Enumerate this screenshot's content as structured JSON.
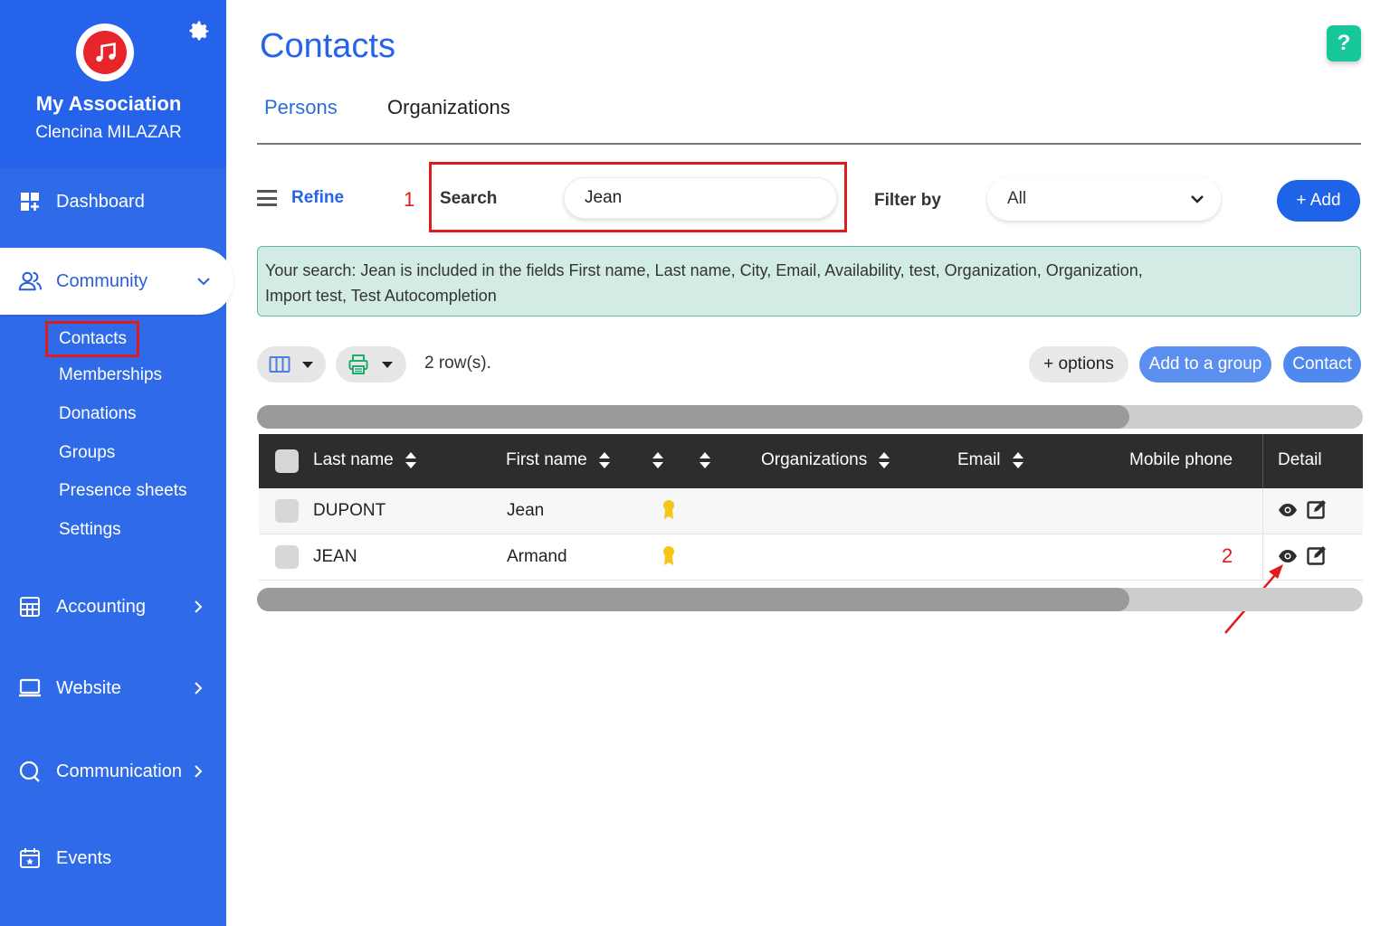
{
  "sidebar": {
    "assoc_name": "My Association",
    "user_name": "Clencina MILAZAR",
    "logo_icon": "music-note-icon",
    "settings_icon": "gear-icon",
    "dashboard": "Dashboard",
    "community": "Community",
    "sub_items": [
      "Contacts",
      "Memberships",
      "Donations",
      "Groups",
      "Presence sheets",
      "Settings"
    ],
    "accounting": "Accounting",
    "website": "Website",
    "communication": "Communication",
    "events": "Events"
  },
  "page": {
    "title": "Contacts",
    "help": "?",
    "tabs": [
      "Persons",
      "Organizations"
    ]
  },
  "toolbar": {
    "refine": "Refine",
    "annotation_1": "1",
    "search_label": "Search",
    "search_value": "Jean",
    "filter_label": "Filter by",
    "filter_value": "All",
    "add": "+ Add"
  },
  "info": {
    "line1": "Your search: Jean is included in the fields First name, Last name, City, Email, Availability, test, Organization, Organization,",
    "line2": "Import test, Test Autocompletion"
  },
  "actions": {
    "row_count": "2 row(s).",
    "options": "+ options",
    "add_to_group": "Add to a group",
    "contact": "Contact"
  },
  "table": {
    "headers": [
      "Last name",
      "First name",
      "",
      "",
      "Organizations",
      "Email",
      "Mobile phone",
      "Detail"
    ],
    "rows": [
      {
        "last_name": "DUPONT",
        "first_name": "Jean"
      },
      {
        "last_name": "JEAN",
        "first_name": "Armand"
      }
    ],
    "annotation_2": "2"
  },
  "colors": {
    "accent": "#2563eb",
    "sidebar": "#2f6be8",
    "annotation": "#e01b1b",
    "info_bg": "#d2ece5",
    "help": "#16c79a"
  }
}
